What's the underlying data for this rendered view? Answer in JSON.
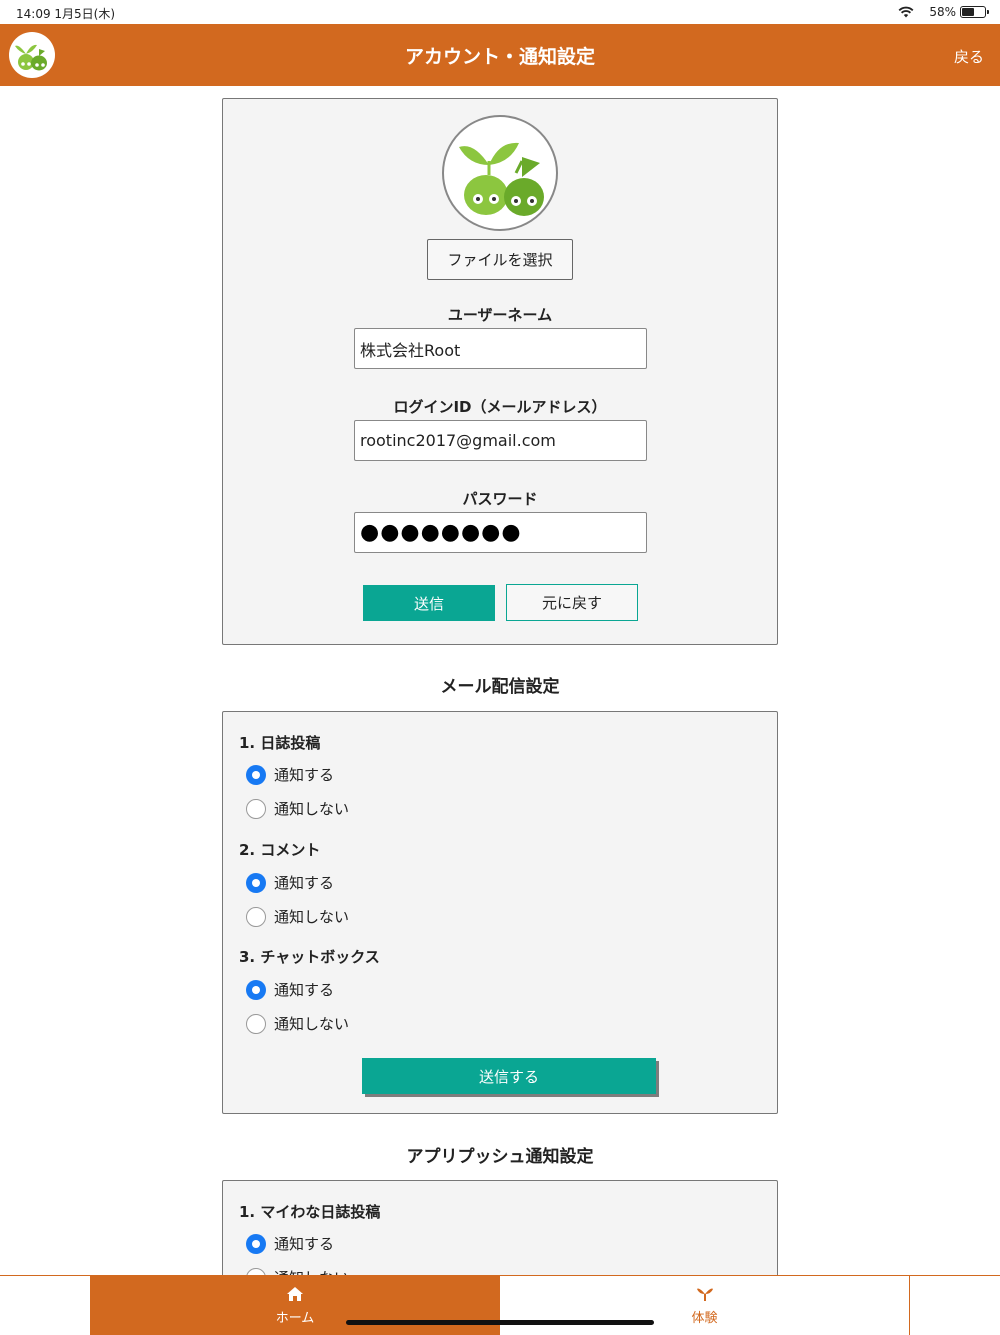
{
  "status_bar": {
    "time": "14:09 1月5日(木)",
    "battery": "58%"
  },
  "header": {
    "title": "アカウント・通知設定",
    "back_label": "戻る"
  },
  "account": {
    "file_button": "ファイルを選択",
    "username_label": "ユーザーネーム",
    "username_value": "株式会社Root",
    "login_label": "ログインID（メールアドレス）",
    "login_value": "rootinc2017@gmail.com",
    "password_label": "パスワード",
    "password_value": "●●●●●●●●",
    "send_label": "送信",
    "reset_label": "元に戻す"
  },
  "mail_settings": {
    "title": "メール配信設定",
    "groups": [
      {
        "title": "1. 日誌投稿",
        "options": [
          "通知する",
          "通知しない"
        ],
        "selected": "通知する"
      },
      {
        "title": "2. コメント",
        "options": [
          "通知する",
          "通知しない"
        ],
        "selected": "通知する"
      },
      {
        "title": "3. チャットボックス",
        "options": [
          "通知する",
          "通知しない"
        ],
        "selected": "通知する"
      }
    ],
    "submit_label": "送信する"
  },
  "push_settings": {
    "title": "アプリプッシュ通知設定",
    "groups": [
      {
        "title": "1. マイわな日誌投稿",
        "options": [
          "通知する",
          "通知しない"
        ],
        "selected": "通知する"
      }
    ]
  },
  "tabbar": {
    "home_label": "ホーム",
    "experience_label": "体験"
  },
  "colors": {
    "brand": "#d2691f",
    "accent": "#0aa693",
    "radio": "#1779f3"
  }
}
